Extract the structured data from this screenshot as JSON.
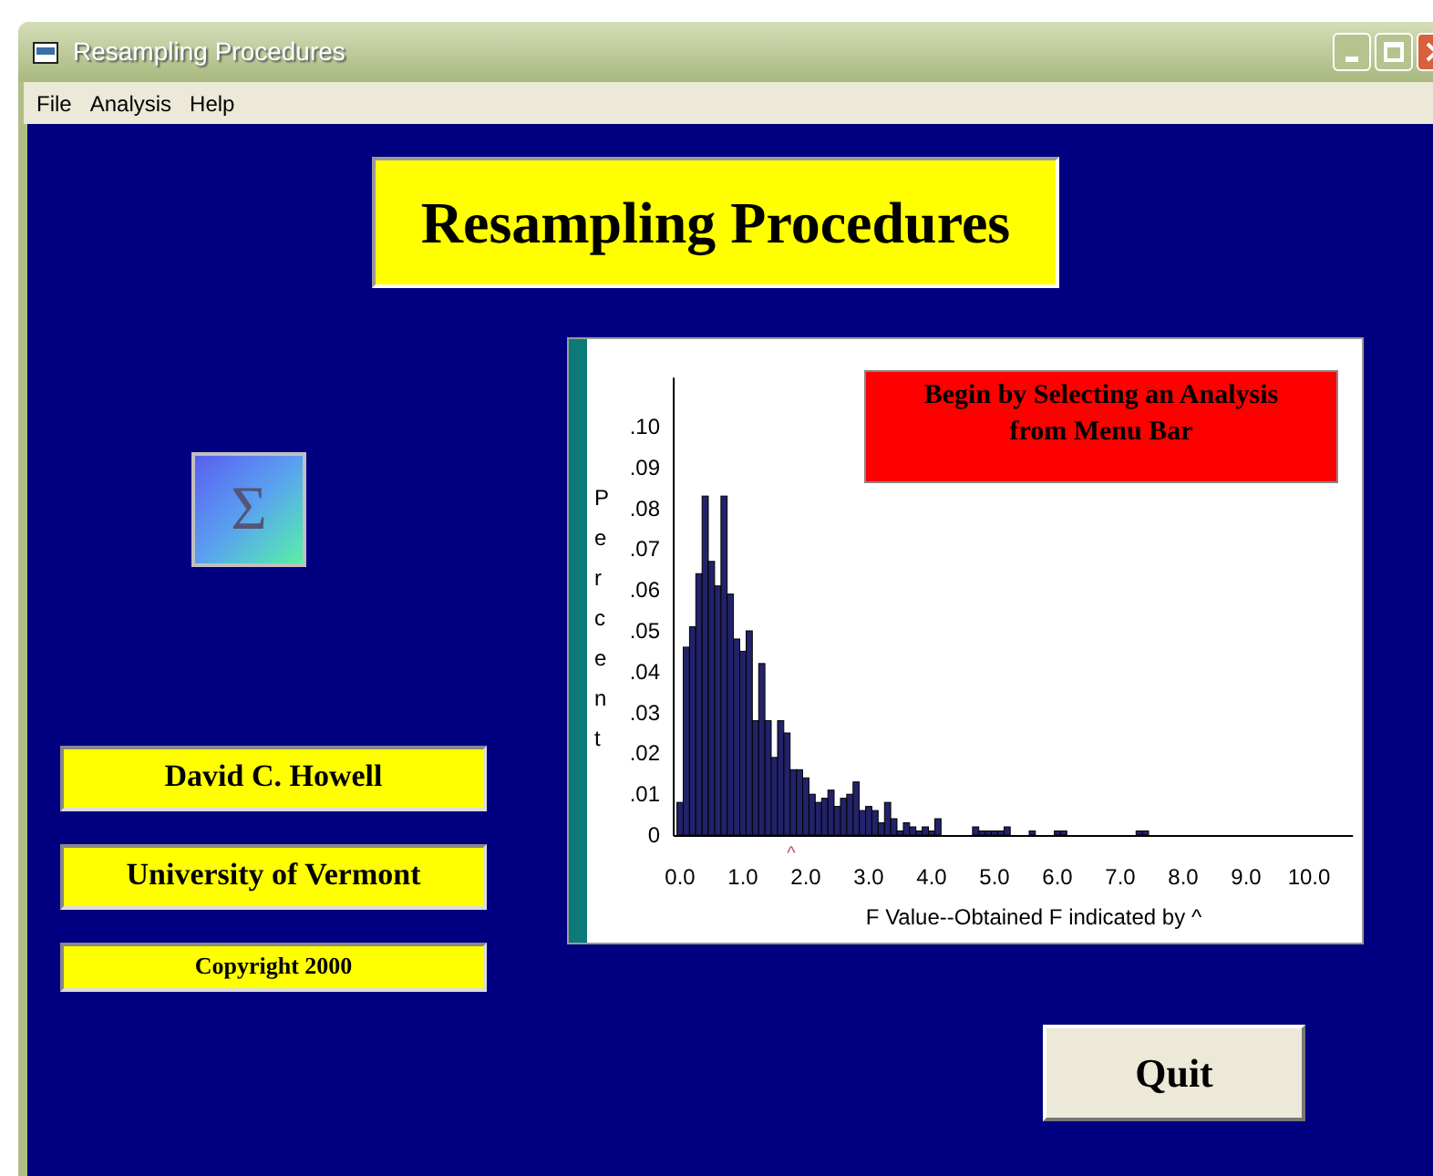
{
  "window": {
    "title": "Resampling Procedures"
  },
  "menu": [
    "File",
    "Analysis",
    "Help"
  ],
  "heading": "Resampling Procedures",
  "sigma_button": {
    "label": "Σ"
  },
  "credits": [
    "David C. Howell",
    "University of Vermont",
    "Copyright 2000"
  ],
  "chart": {
    "message": "Begin by Selecting an Analysis from Menu Bar",
    "obtained_marker": "^",
    "chart_data": {
      "type": "bar",
      "xlabel": "F Value--Obtained F indicated by ^",
      "ylabel": "Percent",
      "x": [
        0.0,
        0.1,
        0.2,
        0.3,
        0.4,
        0.5,
        0.6,
        0.7,
        0.8,
        0.9,
        1.0,
        1.1,
        1.2,
        1.3,
        1.4,
        1.5,
        1.6,
        1.7,
        1.8,
        1.9,
        2.0,
        2.1,
        2.2,
        2.3,
        2.4,
        2.5,
        2.6,
        2.7,
        2.8,
        2.9,
        3.0,
        3.1,
        3.2,
        3.3,
        3.4,
        3.5,
        3.6,
        3.7,
        3.8,
        3.9,
        4.0,
        4.1,
        4.2,
        4.3,
        4.4,
        4.5,
        4.6,
        4.7,
        4.8,
        4.9,
        5.0,
        5.1,
        5.2,
        5.3,
        5.4,
        5.5,
        5.6,
        5.7,
        5.8,
        5.9,
        6.0,
        6.1,
        6.2,
        6.3,
        6.4,
        6.5,
        6.6,
        6.7,
        6.8,
        6.9,
        7.0,
        7.1,
        7.2,
        7.3,
        7.4
      ],
      "values": [
        0.008,
        0.046,
        0.051,
        0.064,
        0.083,
        0.067,
        0.061,
        0.083,
        0.059,
        0.048,
        0.045,
        0.05,
        0.028,
        0.042,
        0.028,
        0.019,
        0.028,
        0.025,
        0.016,
        0.016,
        0.014,
        0.01,
        0.008,
        0.009,
        0.011,
        0.007,
        0.009,
        0.01,
        0.013,
        0.006,
        0.007,
        0.006,
        0.003,
        0.008,
        0.004,
        0.001,
        0.003,
        0.002,
        0.001,
        0.002,
        0.001,
        0.004,
        0,
        0,
        0,
        0,
        0,
        0.002,
        0.001,
        0.001,
        0.001,
        0.001,
        0.002,
        0,
        0,
        0,
        0.001,
        0,
        0,
        0,
        0.001,
        0.001,
        0,
        0,
        0,
        0,
        0,
        0,
        0,
        0,
        0,
        0,
        0,
        0.001,
        0.001
      ],
      "xlim": [
        -0.1,
        10.7
      ],
      "ylim": [
        0,
        0.112
      ],
      "xticks": [
        {
          "value": 0,
          "label": "0.0"
        },
        {
          "value": 1,
          "label": "1.0"
        },
        {
          "value": 2,
          "label": "2.0"
        },
        {
          "value": 3,
          "label": "3.0"
        },
        {
          "value": 4,
          "label": "4.0"
        },
        {
          "value": 5,
          "label": "5.0"
        },
        {
          "value": 6,
          "label": "6.0"
        },
        {
          "value": 7,
          "label": "7.0"
        },
        {
          "value": 8,
          "label": "8.0"
        },
        {
          "value": 9,
          "label": "9.0"
        },
        {
          "value": 10,
          "label": "10.0"
        }
      ],
      "yticks": [
        {
          "value": 0,
          "label": "0"
        },
        {
          "value": 0.01,
          "label": ".01"
        },
        {
          "value": 0.02,
          "label": ".02"
        },
        {
          "value": 0.03,
          "label": ".03"
        },
        {
          "value": 0.04,
          "label": ".04"
        },
        {
          "value": 0.05,
          "label": ".05"
        },
        {
          "value": 0.06,
          "label": ".06"
        },
        {
          "value": 0.07,
          "label": ".07"
        },
        {
          "value": 0.08,
          "label": ".08"
        },
        {
          "value": 0.09,
          "label": ".09"
        },
        {
          "value": 0.1,
          "label": ".10"
        }
      ]
    }
  },
  "quit_button": {
    "label": "Quit"
  }
}
